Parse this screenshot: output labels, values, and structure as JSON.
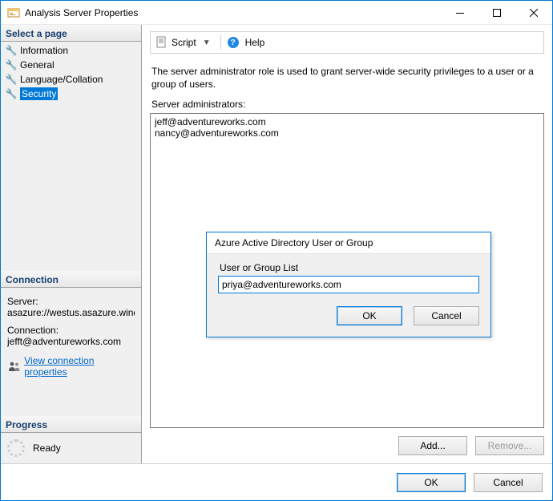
{
  "window": {
    "title": "Analysis Server Properties"
  },
  "sidebar": {
    "select_page_header": "Select a page",
    "pages": [
      {
        "label": "Information",
        "selected": false
      },
      {
        "label": "General",
        "selected": false
      },
      {
        "label": "Language/Collation",
        "selected": false
      },
      {
        "label": "Security",
        "selected": true
      }
    ],
    "connection_header": "Connection",
    "server_label": "Server:",
    "server_value": "asazure://westus.asazure.windows",
    "connection_label": "Connection:",
    "connection_value": "jefft@adventureworks.com",
    "view_connection_link": "View connection properties",
    "progress_header": "Progress",
    "progress_status": "Ready"
  },
  "toolbar": {
    "script_label": "Script",
    "help_label": "Help"
  },
  "main": {
    "description": "The server administrator role is used to grant server-wide security privileges to a user or a group of users.",
    "list_label": "Server administrators:",
    "admins": [
      "jeff@adventureworks.com",
      "nancy@adventureworks.com"
    ],
    "add_label": "Add...",
    "remove_label": "Remove..."
  },
  "inner_dialog": {
    "title": "Azure Active Directory User or Group",
    "field_label": "User or Group List",
    "value": "priya@adventureworks.com",
    "ok_label": "OK",
    "cancel_label": "Cancel"
  },
  "bottom": {
    "ok_label": "OK",
    "cancel_label": "Cancel"
  }
}
